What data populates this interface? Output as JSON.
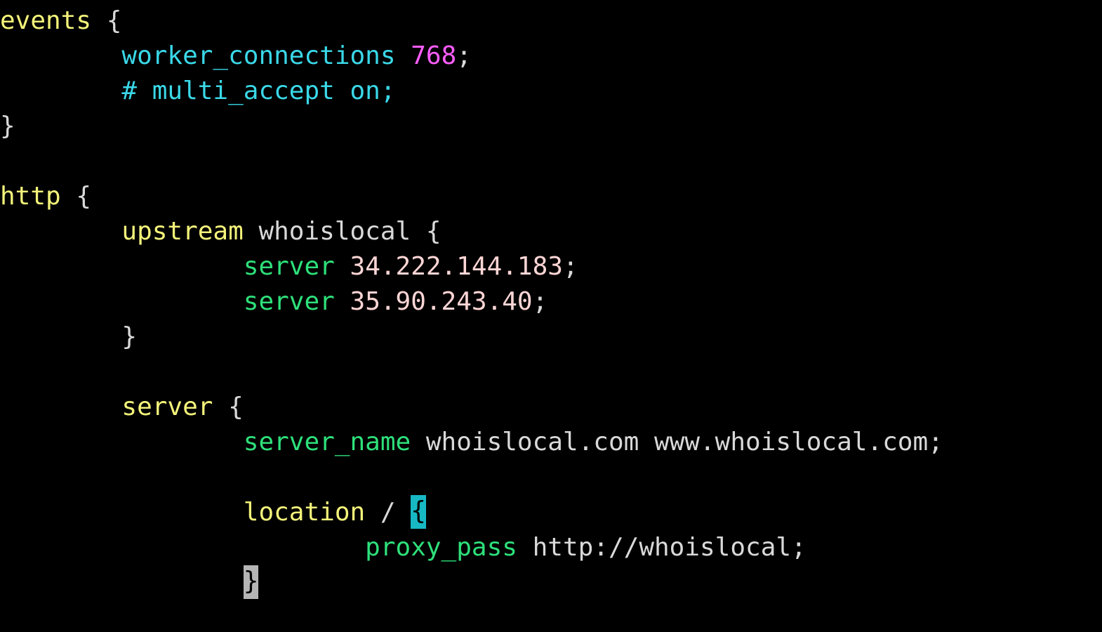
{
  "editor": {
    "background": "#000000",
    "colors": {
      "yellow": "#f3f37a",
      "cyan": "#3ad8e8",
      "magenta": "#ff5dff",
      "green": "#2ee07a",
      "pink": "#ffd6d6",
      "white": "#d9d9d9",
      "bracket_highlight_bg": "#17b8c4",
      "cursor_bg": "#b5b5b5"
    },
    "lines": [
      [
        {
          "t": "events",
          "c": "yellow"
        },
        {
          "t": " {",
          "c": "white"
        }
      ],
      [
        {
          "t": "        ",
          "c": "white"
        },
        {
          "t": "worker_connections",
          "c": "cyan"
        },
        {
          "t": " ",
          "c": "white"
        },
        {
          "t": "768",
          "c": "magenta"
        },
        {
          "t": ";",
          "c": "white"
        }
      ],
      [
        {
          "t": "        ",
          "c": "white"
        },
        {
          "t": "# multi_accept on;",
          "c": "cyan"
        }
      ],
      [
        {
          "t": "}",
          "c": "white"
        }
      ],
      [],
      [
        {
          "t": "http",
          "c": "yellow"
        },
        {
          "t": " {",
          "c": "white"
        }
      ],
      [
        {
          "t": "        ",
          "c": "white"
        },
        {
          "t": "upstream",
          "c": "yellow"
        },
        {
          "t": " whoislocal {",
          "c": "white"
        }
      ],
      [
        {
          "t": "                ",
          "c": "white"
        },
        {
          "t": "server",
          "c": "green"
        },
        {
          "t": " ",
          "c": "white"
        },
        {
          "t": "34.222.144.183",
          "c": "pink"
        },
        {
          "t": ";",
          "c": "white"
        }
      ],
      [
        {
          "t": "                ",
          "c": "white"
        },
        {
          "t": "server",
          "c": "green"
        },
        {
          "t": " ",
          "c": "white"
        },
        {
          "t": "35.90.243.40",
          "c": "pink"
        },
        {
          "t": ";",
          "c": "white"
        }
      ],
      [
        {
          "t": "        ",
          "c": "white"
        },
        {
          "t": "}",
          "c": "white"
        }
      ],
      [],
      [
        {
          "t": "        ",
          "c": "white"
        },
        {
          "t": "server",
          "c": "yellow"
        },
        {
          "t": " {",
          "c": "white"
        }
      ],
      [
        {
          "t": "                ",
          "c": "white"
        },
        {
          "t": "server_name",
          "c": "green"
        },
        {
          "t": " whoislocal.com www.whoislocal.com;",
          "c": "white"
        }
      ],
      [],
      [
        {
          "t": "                ",
          "c": "white"
        },
        {
          "t": "location",
          "c": "yellow"
        },
        {
          "t": " / ",
          "c": "white"
        },
        {
          "t": "{",
          "c": "white",
          "hl": "bracket"
        }
      ],
      [
        {
          "t": "                        ",
          "c": "white"
        },
        {
          "t": "proxy_pass",
          "c": "green"
        },
        {
          "t": " http://whoislocal;",
          "c": "white"
        }
      ],
      [
        {
          "t": "                ",
          "c": "white"
        },
        {
          "t": "}",
          "c": "white",
          "hl": "cursor"
        }
      ]
    ]
  }
}
